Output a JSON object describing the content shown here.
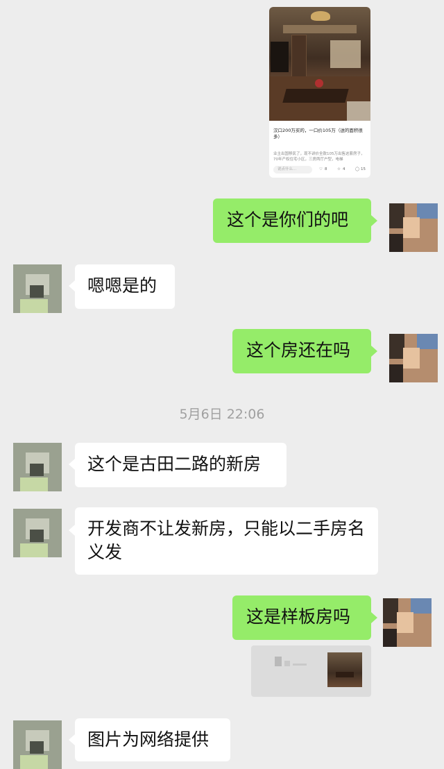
{
  "shared_post": {
    "title": "汉口200万买的，一口价105万（送的面积很多）",
    "description": "业主出国移民了，现不讲价全款105万出售这套房子，70年产权住宅小区，三房两厅户型，电梯",
    "comment_placeholder": "说点什么...",
    "likes": "8",
    "favorites": "4",
    "comments": "15"
  },
  "messages": [
    {
      "sender": "me",
      "text": "这个是你们的吧"
    },
    {
      "sender": "them",
      "text": "嗯嗯是的"
    },
    {
      "sender": "me",
      "text": "这个房还在吗"
    },
    {
      "sender": "them",
      "text": "这个是古田二路的新房"
    },
    {
      "sender": "them",
      "text": "开发商不让发新房，只能以二手房名义发"
    },
    {
      "sender": "me",
      "text": "这是样板房吗"
    },
    {
      "sender": "them",
      "text": "图片为网络提供"
    }
  ],
  "timestamp": "5月6日 22:06",
  "colors": {
    "my_bubble": "#95ec69",
    "their_bubble": "#ffffff",
    "background": "#ededed"
  }
}
